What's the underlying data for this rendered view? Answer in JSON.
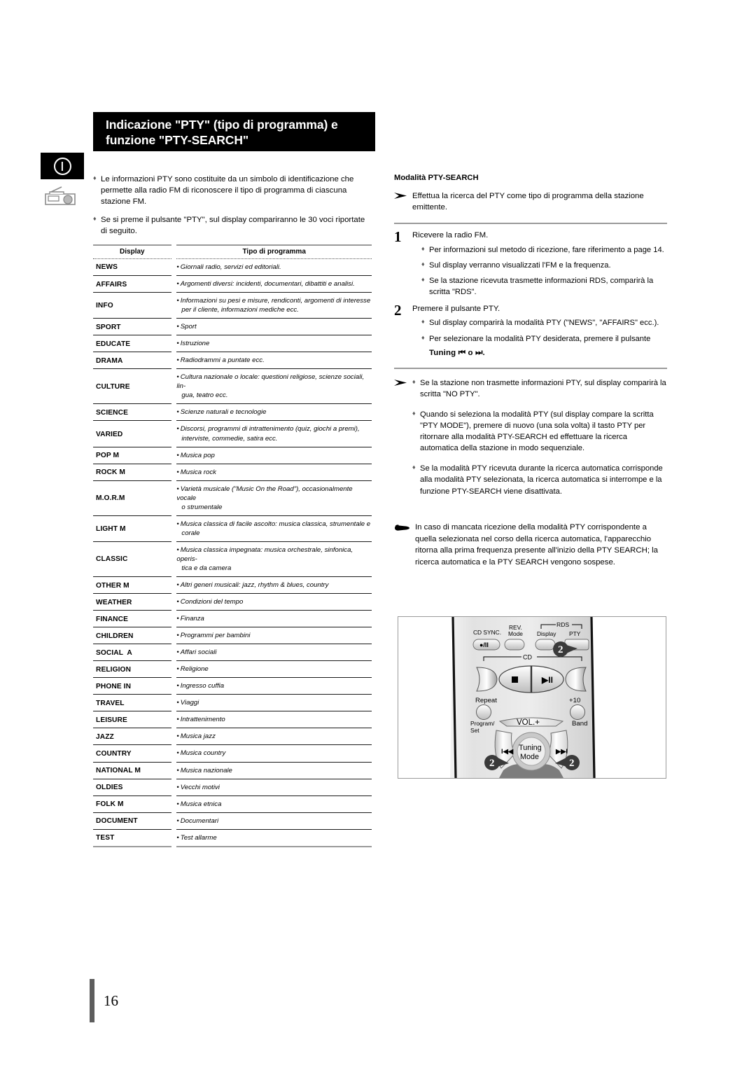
{
  "page": {
    "number": "16",
    "title_line1": "Indicazione \"PTY\" (tipo di programma) e",
    "title_line2": "funzione \"PTY-SEARCH\""
  },
  "margin_icons": {
    "power_label": "power-exclamation-icon",
    "radio_label": "radio-icon"
  },
  "left": {
    "intro": [
      "Le informazioni PTY sono costituite da un simbolo di identificazione che permette alla radio FM di riconoscere il tipo di programma di ciascuna stazione FM.",
      "Se si preme il pulsante \"PTY\", sul display compariranno le 30 voci riportate di seguito."
    ],
    "table": {
      "headers": [
        "Display",
        "Tipo di programma"
      ],
      "rows": [
        {
          "display": "NEWS",
          "desc": "Giornali radio, servizi ed editoriali.",
          "desc2": ""
        },
        {
          "display": "AFFAIRS",
          "desc": "Argomenti diversi: incidenti, documentari, dibattiti e analisi.",
          "desc2": ""
        },
        {
          "display": "INFO",
          "desc": "Informazioni su pesi e misure, rendiconti, argomenti di interesse",
          "desc2": "per il cliente, informazioni mediche ecc."
        },
        {
          "display": "SPORT",
          "desc": "Sport",
          "desc2": ""
        },
        {
          "display": "EDUCATE",
          "desc": "Istruzione",
          "desc2": ""
        },
        {
          "display": "DRAMA",
          "desc": "Radiodrammi a puntate ecc.",
          "desc2": ""
        },
        {
          "display": "CULTURE",
          "desc": "Cultura nazionale o locale: questioni religiose, scienze sociali, lin-",
          "desc2": "gua, teatro ecc."
        },
        {
          "display": "SCIENCE",
          "desc": "Scienze naturali e tecnologie",
          "desc2": ""
        },
        {
          "display": "VARIED",
          "desc": "Discorsi, programmi di intrattenimento (quiz, giochi a premi),",
          "desc2": "interviste, commedie, satira ecc."
        },
        {
          "display": "POP M",
          "desc": "Musica pop",
          "desc2": ""
        },
        {
          "display": "ROCK M",
          "desc": "Musica rock",
          "desc2": ""
        },
        {
          "display": "M.O.R.M",
          "desc": "Varietà musicale (\"Music On the Road\"), occasionalmente vocale",
          "desc2": "o strumentale"
        },
        {
          "display": "LIGHT M",
          "desc": "Musica classica di facile ascolto: musica classica, strumentale e",
          "desc2": "corale"
        },
        {
          "display": "CLASSIC",
          "desc": "Musica classica impegnata: musica orchestrale, sinfonica, operis-",
          "desc2": "tica e da camera"
        },
        {
          "display": "OTHER M",
          "desc": "Altri generi musicali: jazz, rhythm & blues, country",
          "desc2": ""
        },
        {
          "display": "WEATHER",
          "desc": "Condizioni del tempo",
          "desc2": ""
        },
        {
          "display": "FINANCE",
          "desc": "Finanza",
          "desc2": ""
        },
        {
          "display": "CHILDREN",
          "desc": "Programmi per bambini",
          "desc2": ""
        },
        {
          "display": "SOCIAL  A",
          "desc": "Affari sociali",
          "desc2": ""
        },
        {
          "display": "RELIGION",
          "desc": "Religione",
          "desc2": ""
        },
        {
          "display": "PHONE IN",
          "desc": "Ingresso cuffia",
          "desc2": ""
        },
        {
          "display": "TRAVEL",
          "desc": "Viaggi",
          "desc2": ""
        },
        {
          "display": "LEISURE",
          "desc": "Intrattenimento",
          "desc2": ""
        },
        {
          "display": "JAZZ",
          "desc": "Musica jazz",
          "desc2": ""
        },
        {
          "display": "COUNTRY",
          "desc": "Musica country",
          "desc2": ""
        },
        {
          "display": "NATIONAL M",
          "desc": "Musica nazionale",
          "desc2": ""
        },
        {
          "display": "OLDIES",
          "desc": "Vecchi motivi",
          "desc2": ""
        },
        {
          "display": "FOLK M",
          "desc": "Musica etnica",
          "desc2": ""
        },
        {
          "display": "DOCUMENT",
          "desc": "Documentari",
          "desc2": ""
        },
        {
          "display": "TEST",
          "desc": "Test allarme",
          "desc2": ""
        }
      ]
    }
  },
  "right": {
    "mode_heading": "Modalità PTY-SEARCH",
    "mode_intro": "Effettua la ricerca del PTY come tipo di programma della stazione emittente.",
    "steps": [
      {
        "num": "1",
        "lead": "Ricevere la radio FM.",
        "bullets": [
          "Per informazioni sul metodo di ricezione, fare riferimento a page 14.",
          "Sul display verranno visualizzati l'FM e la frequenza.",
          "Se la stazione ricevuta trasmette informazioni RDS, comparirà la scritta \"RDS\"."
        ]
      },
      {
        "num": "2",
        "lead": "Premere il pulsante PTY.",
        "bullets": [
          "Sul display comparirà la modalità PTY (\"NEWS\", \"AFFAIRS\" ecc.).",
          "Per selezionare la modalità PTY desiderata, premere il pulsante"
        ],
        "tuning_label": "Tuning",
        "tuning_suffix": "o",
        "tuning_end": "."
      }
    ],
    "notes": [
      "Se la stazione non trasmette informazioni PTY, sul display comparirà la scritta \"NO PTY\".",
      "Quando si seleziona la modalità PTY (sul display compare la scritta \"PTY MODE\"), premere di nuovo (una sola volta) il tasto PTY per ritornare alla modalità PTY-SEARCH ed effettuare la ricerca automatica della stazione in modo sequenziale.",
      "Se la modalità PTY ricevuta durante la ricerca automatica corrisponde alla modalità PTY selezionata, la ricerca automatica si interrompe e la funzione PTY-SEARCH viene disattivata."
    ],
    "hand_note": "In caso di mancata ricezione della modalità PTY corrispondente a quella selezionata nel corso della ricerca automatica, l'apparecchio ritorna alla prima frequenza presente all'inizio della PTY SEARCH; la ricerca automatica e la PTY SEARCH vengono sospese."
  },
  "remote": {
    "labels": {
      "cd_sync": "CD SYNC.",
      "rev_mode_l1": "REV.",
      "rev_mode_l2": "Mode",
      "display": "Display",
      "pty": "PTY",
      "rds": "RDS",
      "cd": "CD",
      "repeat": "Repeat",
      "plus_ten": "+10",
      "program_l1": "Program/",
      "program_l2": "Set",
      "band": "Band",
      "vol_plus": "VOL.+",
      "tuning_l1": "Tuning",
      "tuning_l2": "Mode",
      "rec_pause": "●/II",
      "stop": "■",
      "play_pause": "▶II",
      "skip_back": "I◀◀",
      "skip_fwd": "▶▶I"
    },
    "callouts": [
      "2",
      "2",
      "2"
    ],
    "accent": "#3a3a3a"
  }
}
